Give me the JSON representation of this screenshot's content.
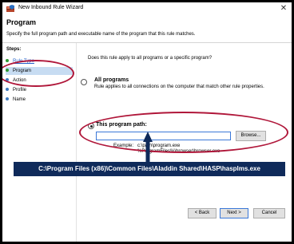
{
  "window": {
    "title": "New Inbound Rule Wizard",
    "close_glyph": "✕"
  },
  "header": {
    "title": "Program",
    "subtitle": "Specify the full program path and executable name of the program that this rule matches."
  },
  "steps": {
    "heading": "Steps:",
    "items": [
      {
        "label": "Rule Type",
        "state": "done"
      },
      {
        "label": "Program",
        "state": "current"
      },
      {
        "label": "Action",
        "state": "pending"
      },
      {
        "label": "Profile",
        "state": "pending"
      },
      {
        "label": "Name",
        "state": "pending"
      }
    ]
  },
  "content": {
    "question": "Does this rule apply to all programs or a specific program?",
    "all_programs": {
      "label": "All programs",
      "description": "Rule applies to all connections on the computer that match other rule properties.",
      "selected": false
    },
    "this_program": {
      "label": "This program path:",
      "selected": true,
      "path_value": "",
      "browse_label": "Browse...",
      "example_label": "Example:",
      "example_lines": [
        "c:\\path\\program.exe",
        "%ProgramFiles%\\browser\\browser.exe"
      ]
    }
  },
  "buttons": {
    "back": "< Back",
    "next": "Next >",
    "cancel": "Cancel"
  },
  "annotation": {
    "callout_text": "C:\\Program Files (x86)\\Common Files\\Aladdin Shared\\HASP\\hasplms.exe",
    "highlight_color": "#b0173a",
    "callout_bg": "#0f2a5a"
  },
  "icons": {
    "app": "firewall-shield-icon",
    "close": "close-icon"
  }
}
